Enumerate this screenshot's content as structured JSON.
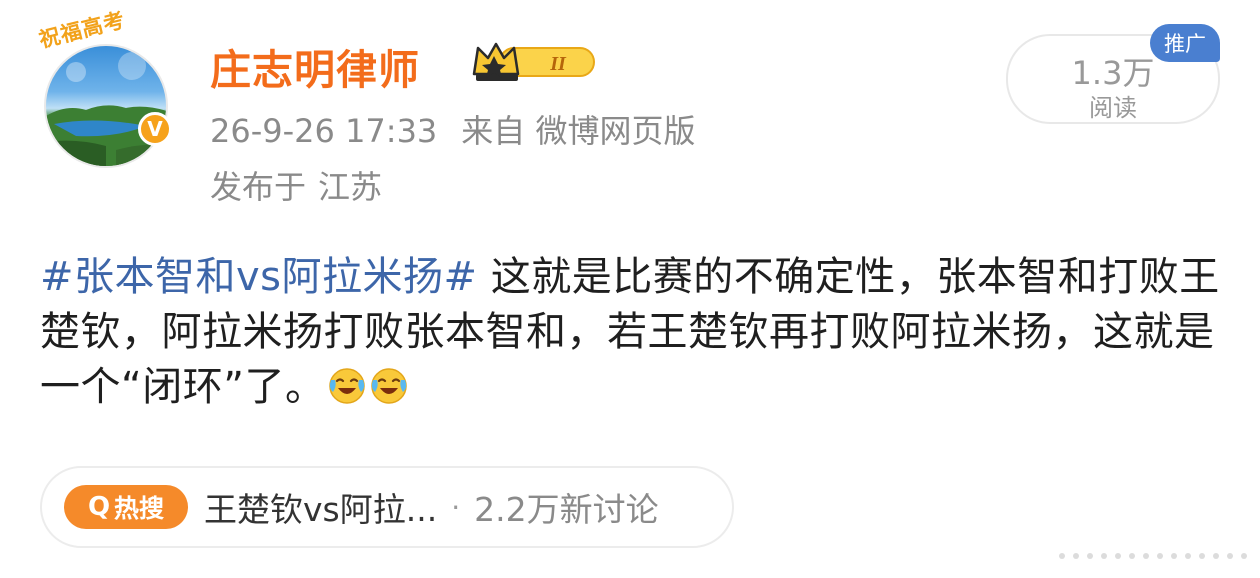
{
  "author": {
    "avatar_deco_text": "祝福高考",
    "name": "庄志明律师",
    "vip_level": "II",
    "verified_mark": "V"
  },
  "meta": {
    "time": "26-9-26 17:33",
    "source": "来自 微博网页版",
    "location_prefix": "发布于",
    "location": "江苏"
  },
  "stats": {
    "read_count": "1.3万",
    "read_label": "阅读",
    "promo_tag": "推广"
  },
  "post": {
    "hashtag": "#张本智和vs阿拉米扬#",
    "text": " 这就是比赛的不确定性，张本智和打败王楚钦，阿拉米扬打败张本智和，若王楚钦再打败阿拉米扬，这就是一个“闭环”了。",
    "emojis": [
      "laughing-crying-emoji",
      "laughing-crying-emoji"
    ]
  },
  "hot_search": {
    "badge_icon": "Q",
    "badge": "热搜",
    "title": "王楚钦vs阿拉...",
    "separator": "·",
    "discussion": "2.2万新讨论"
  },
  "colors": {
    "name": "#f36c1b",
    "hashtag": "#3d66a9",
    "meta": "#8a8a8a",
    "promo": "#4a7fd0",
    "hot_badge": "#f58a2a"
  }
}
